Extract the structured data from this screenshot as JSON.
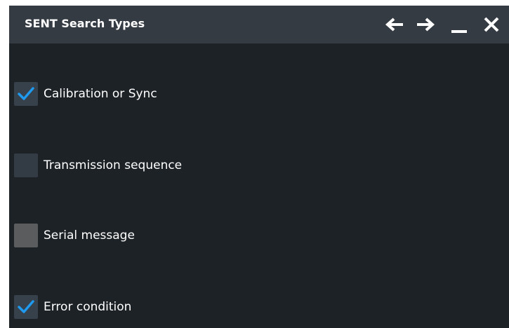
{
  "dialog": {
    "title": "SENT Search Types",
    "buttons": {
      "back": "arrow-left-icon",
      "forward": "arrow-right-icon",
      "minimize": "minimize-icon",
      "close": "close-icon"
    }
  },
  "options": [
    {
      "label": "Calibration or Sync",
      "checked": true,
      "enabled": true
    },
    {
      "label": "Transmission sequence",
      "checked": false,
      "enabled": true
    },
    {
      "label": "Serial message",
      "checked": false,
      "enabled": false
    },
    {
      "label": "Error condition",
      "checked": true,
      "enabled": true
    }
  ],
  "colors": {
    "background": "#1d2227",
    "titlebar": "#343b43",
    "check_accent": "#1e9bf0",
    "text": "#ffffff"
  }
}
